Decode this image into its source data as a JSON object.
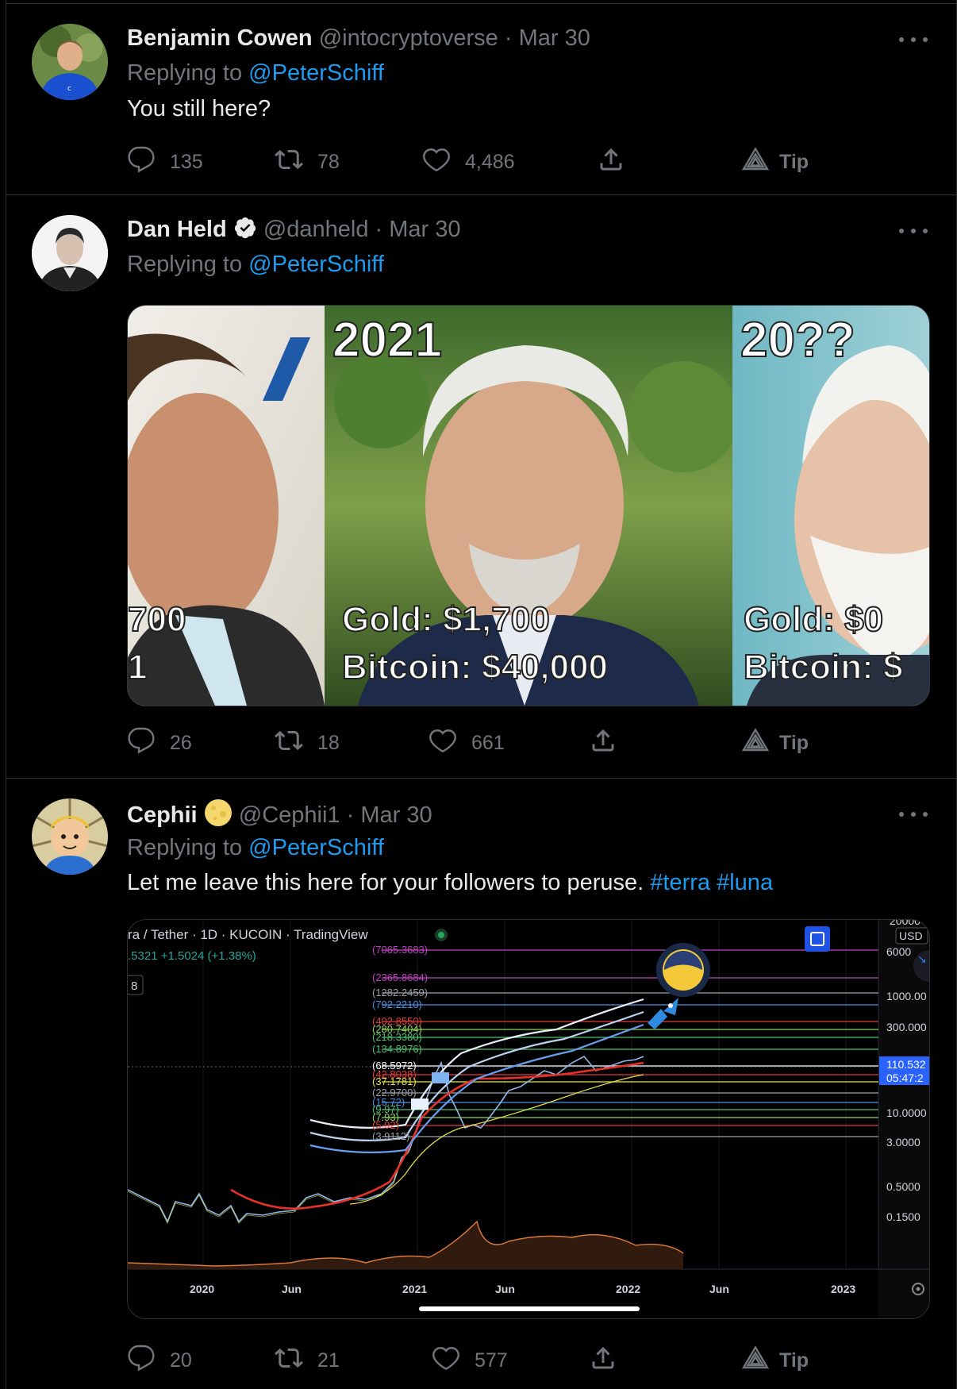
{
  "tweets": [
    {
      "name": "Benjamin Cowen",
      "handle": "@intocryptoverse",
      "separator": "·",
      "date": "Mar 30",
      "replying_prefix": "Replying to",
      "replying_to": "@PeterSchiff",
      "text": "You still here?",
      "counts": {
        "replies": "135",
        "retweets": "78",
        "likes": "4,486"
      },
      "tip_label": "Tip"
    },
    {
      "name": "Dan Held",
      "handle": "@danheld",
      "separator": "·",
      "date": "Mar 30",
      "replying_prefix": "Replying to",
      "replying_to": "@PeterSchiff",
      "verified": true,
      "counts": {
        "replies": "26",
        "retweets": "18",
        "likes": "661"
      },
      "tip_label": "Tip",
      "meme": {
        "left_lines": [
          "700",
          "1"
        ],
        "mid_year": "2021",
        "mid_lines": [
          "Gold: $1,700",
          "Bitcoin: $40,000"
        ],
        "right_year": "20??",
        "right_lines": [
          "Gold: $0",
          "Bitcoin: $"
        ]
      }
    },
    {
      "name": "Cephii",
      "handle": "@Cephii1",
      "separator": "·",
      "date": "Mar 30",
      "replying_prefix": "Replying to",
      "replying_to": "@PeterSchiff",
      "text": "Let me leave this here for your followers to peruse.",
      "hashtags": [
        "#terra",
        "#luna"
      ],
      "counts": {
        "replies": "20",
        "retweets": "21",
        "likes": "577"
      },
      "tip_label": "Tip"
    }
  ],
  "chart": {
    "symbol_line": "ra / Tether · 1D · KUCOIN · TradingView",
    "price_line": ".5321 +1.5024 (+1.38%)",
    "interval_box": "8",
    "currency": "USD",
    "y_ticks": [
      "20000",
      "6000",
      "1000.00",
      "300.000",
      "10.0000",
      "3.0000",
      "0.5000",
      "0.1500"
    ],
    "price_label": "110.532",
    "countdown_label": "05:47:2",
    "x_ticks": [
      "2020",
      "Jun",
      "2021",
      "Jun",
      "2022",
      "Jun",
      "2023"
    ],
    "levels": [
      {
        "label": "(7065.3683)",
        "color": "#c040c0"
      },
      {
        "label": "(2365.8684)",
        "color": "#c040c0"
      },
      {
        "label": "(1282.2459)",
        "color": "#9aa0a6"
      },
      {
        "label": "(792.2210)",
        "color": "#4a8fe0"
      },
      {
        "label": "(402.8550)",
        "color": "#e03a3a"
      },
      {
        "label": "(280.7404)",
        "color": "#8fd35c"
      },
      {
        "label": "(218.3380)",
        "color": "#4cc070"
      },
      {
        "label": "(134.8976)",
        "color": "#4cc070"
      },
      {
        "label": "(68.5972)",
        "color": "#ffffff"
      },
      {
        "label": "(42.8038)",
        "color": "#e03a3a"
      },
      {
        "label": "(37.1781)",
        "color": "#e6e04a"
      },
      {
        "label": "(22.9700)",
        "color": "#9aa0a6"
      },
      {
        "label": "(15.72)",
        "color": "#4a8fe0"
      },
      {
        "label": "(9.97)",
        "color": "#4cc070"
      },
      {
        "label": "(7.93)",
        "color": "#8fd35c"
      },
      {
        "label": "(5.92)",
        "color": "#e03a3a"
      },
      {
        "label": "(3.9112)",
        "color": "#9aa0a6"
      }
    ]
  }
}
